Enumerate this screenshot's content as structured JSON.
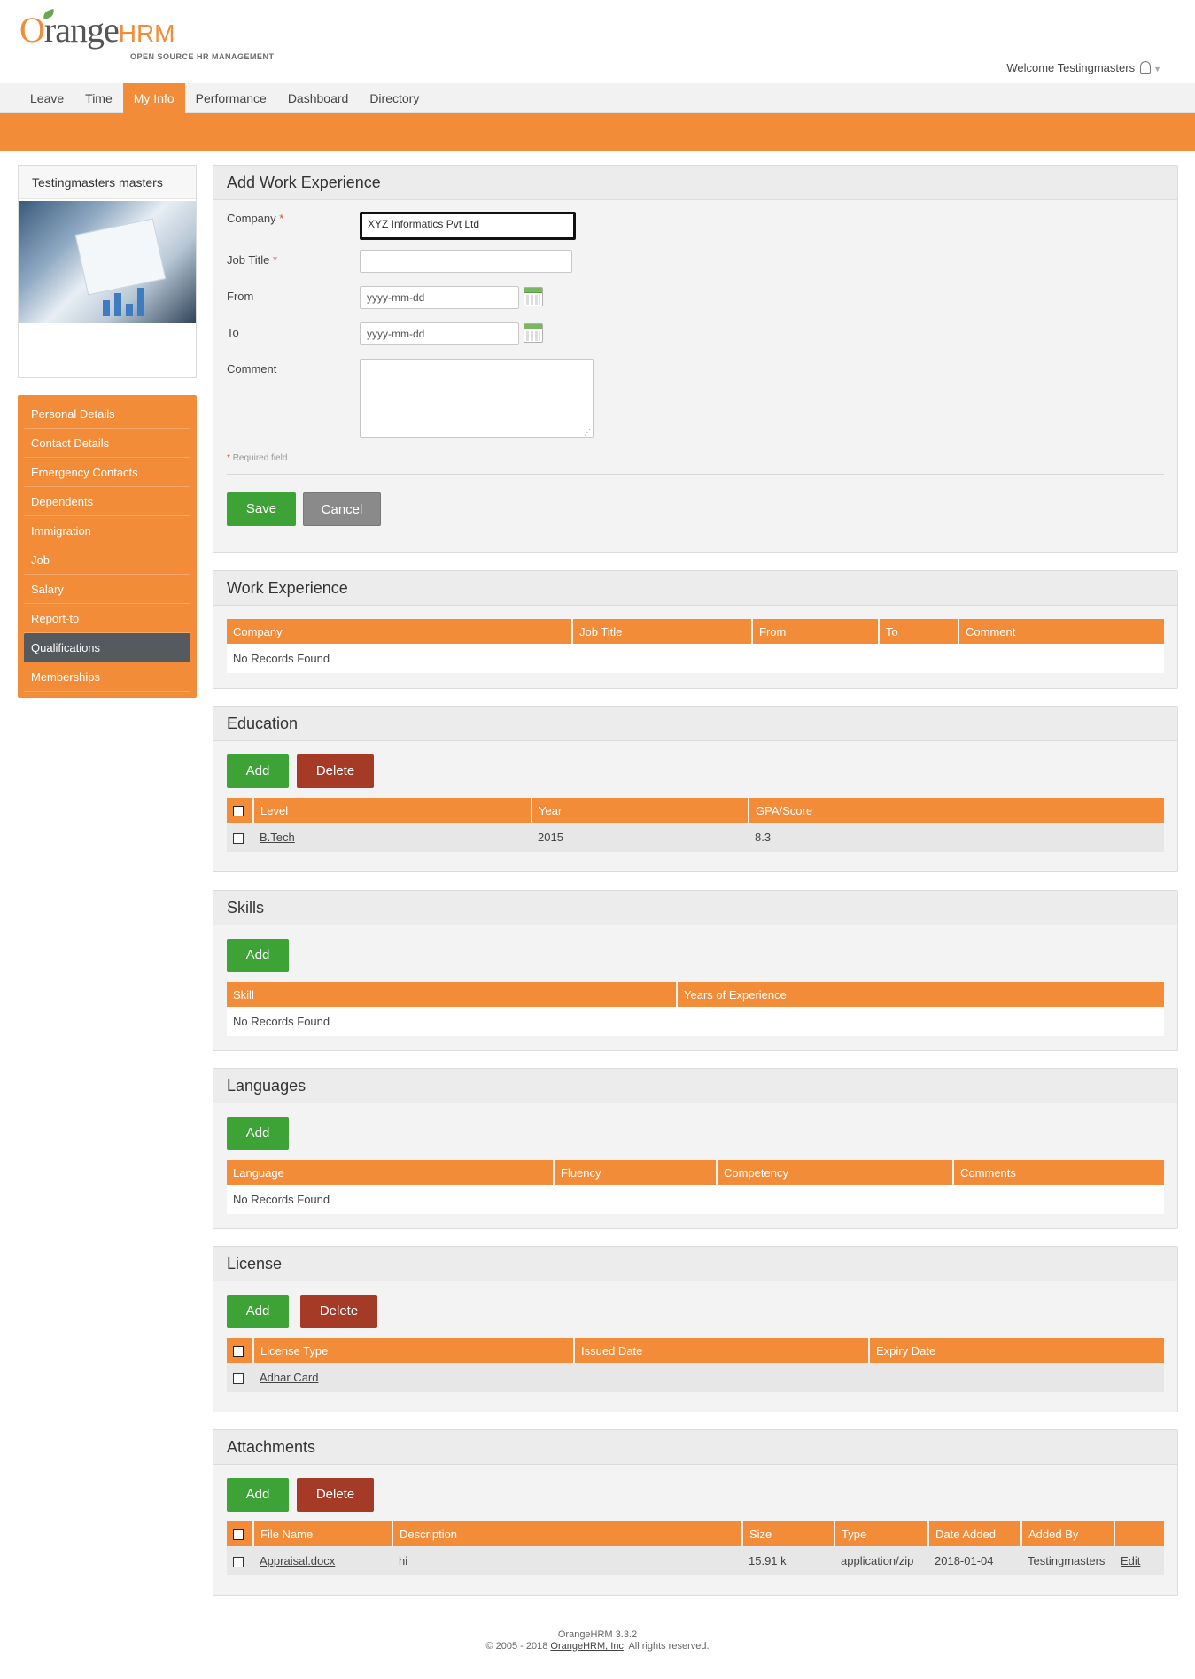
{
  "brand": {
    "logo_o": "O",
    "logo_rest": "range",
    "logo_hrm": "HRM",
    "tagline": "OPEN SOURCE HR MANAGEMENT",
    "accent_color": "#f28c38"
  },
  "header": {
    "welcome": "Welcome Testingmasters",
    "user_icon": "user-icon"
  },
  "nav": {
    "items": [
      "Leave",
      "Time",
      "My Info",
      "Performance",
      "Dashboard",
      "Directory"
    ],
    "active": "My Info"
  },
  "profile": {
    "name": "Testingmasters masters"
  },
  "sidebar": {
    "items": [
      "Personal Details",
      "Contact Details",
      "Emergency Contacts",
      "Dependents",
      "Immigration",
      "Job",
      "Salary",
      "Report-to",
      "Qualifications",
      "Memberships"
    ],
    "active": "Qualifications"
  },
  "add_work_experience": {
    "title": "Add Work Experience",
    "company_label": "Company",
    "company_value": "XYZ Informatics Pvt Ltd",
    "job_title_label": "Job Title",
    "job_title_value": "",
    "from_label": "From",
    "from_placeholder": "yyyy-mm-dd",
    "to_label": "To",
    "to_placeholder": "yyyy-mm-dd",
    "comment_label": "Comment",
    "required_marker": "*",
    "required_note": "Required field",
    "save_label": "Save",
    "cancel_label": "Cancel"
  },
  "work_experience": {
    "title": "Work Experience",
    "columns": [
      "Company",
      "Job Title",
      "From",
      "To",
      "Comment"
    ],
    "empty": "No Records Found"
  },
  "education": {
    "title": "Education",
    "add_label": "Add",
    "delete_label": "Delete",
    "columns": [
      "Level",
      "Year",
      "GPA/Score"
    ],
    "rows": [
      {
        "level": "B.Tech",
        "year": "2015",
        "score": "8.3"
      }
    ]
  },
  "skills": {
    "title": "Skills",
    "add_label": "Add",
    "columns": [
      "Skill",
      "Years of Experience"
    ],
    "empty": "No Records Found"
  },
  "languages": {
    "title": "Languages",
    "add_label": "Add",
    "columns": [
      "Language",
      "Fluency",
      "Competency",
      "Comments"
    ],
    "empty": "No Records Found"
  },
  "license": {
    "title": "License",
    "add_label": "Add",
    "delete_label": "Delete",
    "columns": [
      "License Type",
      "Issued Date",
      "Expiry Date"
    ],
    "rows": [
      {
        "type": "Adhar Card",
        "issued": "",
        "expiry": ""
      }
    ]
  },
  "attachments": {
    "title": "Attachments",
    "add_label": "Add",
    "delete_label": "Delete",
    "columns": [
      "File Name",
      "Description",
      "Size",
      "Type",
      "Date Added",
      "Added By",
      ""
    ],
    "rows": [
      {
        "file": "Appraisal.docx",
        "description": "hi",
        "size": "15.91 k",
        "type": "application/zip",
        "date": "2018-01-04",
        "added_by": "Testingmasters",
        "action": "Edit"
      }
    ]
  },
  "footer": {
    "version": "OrangeHRM 3.3.2",
    "copyright_prefix": "© 2005 - 2018",
    "company_link": "OrangeHRM, Inc",
    "copyright_suffix": ". All rights reserved."
  }
}
